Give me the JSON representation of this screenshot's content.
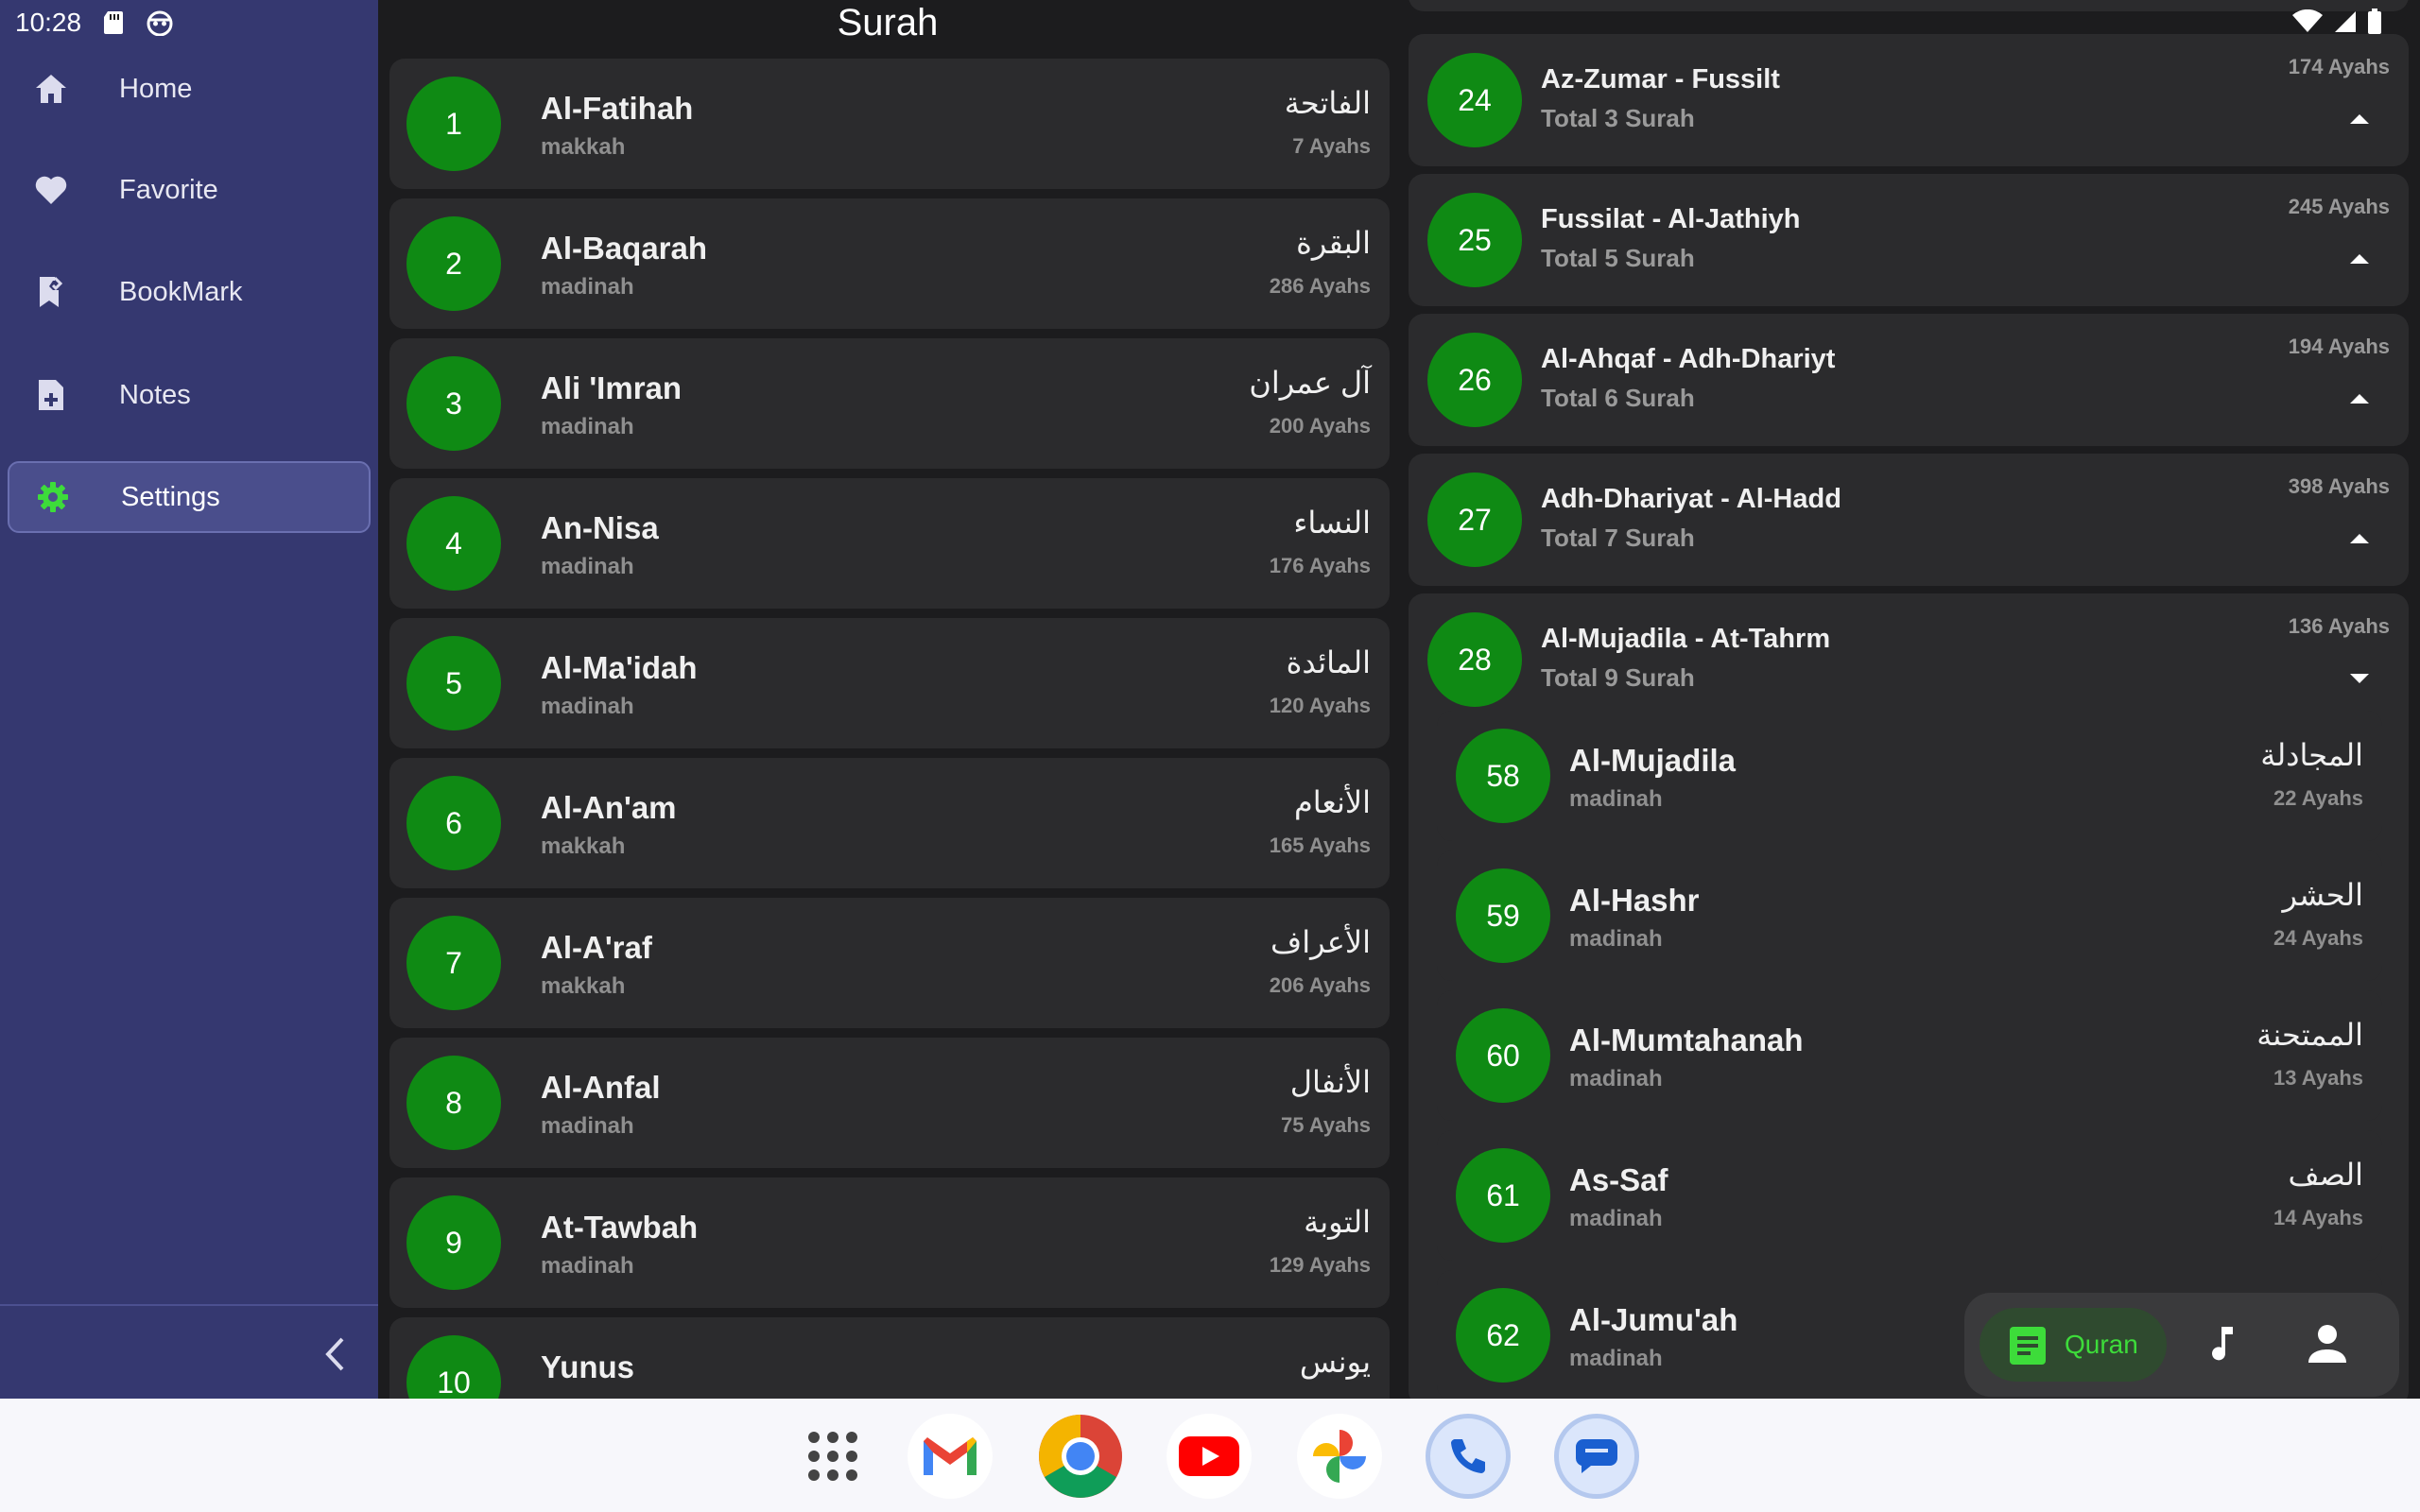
{
  "status_bar": {
    "time": "10:28",
    "left_icons": [
      "sd-card-icon",
      "android-debug-icon"
    ],
    "right_icons": [
      "wifi-icon",
      "cell-signal-icon",
      "battery-icon"
    ]
  },
  "sidebar": {
    "items": [
      {
        "label": "Home",
        "icon": "home-icon",
        "active": false
      },
      {
        "label": "Favorite",
        "icon": "heart-icon",
        "active": false
      },
      {
        "label": "BookMark",
        "icon": "bookmark-icon",
        "active": false
      },
      {
        "label": "Notes",
        "icon": "note-add-icon",
        "active": false
      },
      {
        "label": "Settings",
        "icon": "gear-icon",
        "active": true
      }
    ],
    "collapse_icon": "chevron-left-icon"
  },
  "main": {
    "title": "Surah",
    "surahs": [
      {
        "number": "1",
        "name": "Al-Fatihah",
        "place": "makkah",
        "arabic": "الفاتحة",
        "ayahs": "7 Ayahs"
      },
      {
        "number": "2",
        "name": "Al-Baqarah",
        "place": "madinah",
        "arabic": "البقرة",
        "ayahs": "286 Ayahs"
      },
      {
        "number": "3",
        "name": "Ali 'Imran",
        "place": "madinah",
        "arabic": "آل عمران",
        "ayahs": "200 Ayahs"
      },
      {
        "number": "4",
        "name": "An-Nisa",
        "place": "madinah",
        "arabic": "النساء",
        "ayahs": "176 Ayahs"
      },
      {
        "number": "5",
        "name": "Al-Ma'idah",
        "place": "madinah",
        "arabic": "المائدة",
        "ayahs": "120 Ayahs"
      },
      {
        "number": "6",
        "name": "Al-An'am",
        "place": "makkah",
        "arabic": "الأنعام",
        "ayahs": "165 Ayahs"
      },
      {
        "number": "7",
        "name": "Al-A'raf",
        "place": "makkah",
        "arabic": "الأعراف",
        "ayahs": "206 Ayahs"
      },
      {
        "number": "8",
        "name": "Al-Anfal",
        "place": "madinah",
        "arabic": "الأنفال",
        "ayahs": "75 Ayahs"
      },
      {
        "number": "9",
        "name": "At-Tawbah",
        "place": "madinah",
        "arabic": "التوبة",
        "ayahs": "129 Ayahs"
      },
      {
        "number": "10",
        "name": "Yunus",
        "place": "",
        "arabic": "يونس",
        "ayahs": ""
      }
    ]
  },
  "juz": {
    "items": [
      {
        "number": "24",
        "title": "Az-Zumar - Fussilt",
        "total": "Total 3 Surah",
        "ayahs": "174 Ayahs",
        "expanded": false
      },
      {
        "number": "25",
        "title": "Fussilat - Al-Jathiyh",
        "total": "Total 5 Surah",
        "ayahs": "245 Ayahs",
        "expanded": false
      },
      {
        "number": "26",
        "title": "Al-Ahqaf - Adh-Dhariyt",
        "total": "Total 6 Surah",
        "ayahs": "194 Ayahs",
        "expanded": false
      },
      {
        "number": "27",
        "title": "Adh-Dhariyat - Al-Hadd",
        "total": "Total 7 Surah",
        "ayahs": "398 Ayahs",
        "expanded": false
      },
      {
        "number": "28",
        "title": "Al-Mujadila - At-Tahrm",
        "total": "Total 9 Surah",
        "ayahs": "136 Ayahs",
        "expanded": true
      }
    ],
    "expanded_surahs": [
      {
        "number": "58",
        "name": "Al-Mujadila",
        "place": "madinah",
        "arabic": "المجادلة",
        "ayahs": "22 Ayahs"
      },
      {
        "number": "59",
        "name": "Al-Hashr",
        "place": "madinah",
        "arabic": "الحشر",
        "ayahs": "24 Ayahs"
      },
      {
        "number": "60",
        "name": "Al-Mumtahanah",
        "place": "madinah",
        "arabic": "الممتحنة",
        "ayahs": "13 Ayahs"
      },
      {
        "number": "61",
        "name": "As-Saf",
        "place": "madinah",
        "arabic": "الصف",
        "ayahs": "14 Ayahs"
      },
      {
        "number": "62",
        "name": "Al-Jumu'ah",
        "place": "madinah",
        "arabic": "",
        "ayahs": ""
      }
    ]
  },
  "bottom_nav": {
    "quran_label": "Quran",
    "icons": [
      "quran-book-icon",
      "music-note-icon",
      "person-icon"
    ]
  },
  "dock": {
    "apps": [
      "app-drawer-icon",
      "gmail-icon",
      "chrome-icon",
      "youtube-icon",
      "photos-icon",
      "phone-icon",
      "messages-icon"
    ]
  },
  "colors": {
    "sidebar": "#353870",
    "accent_green": "#0f8a14",
    "card": "#2b2b2d",
    "background": "#1c1c1e"
  }
}
